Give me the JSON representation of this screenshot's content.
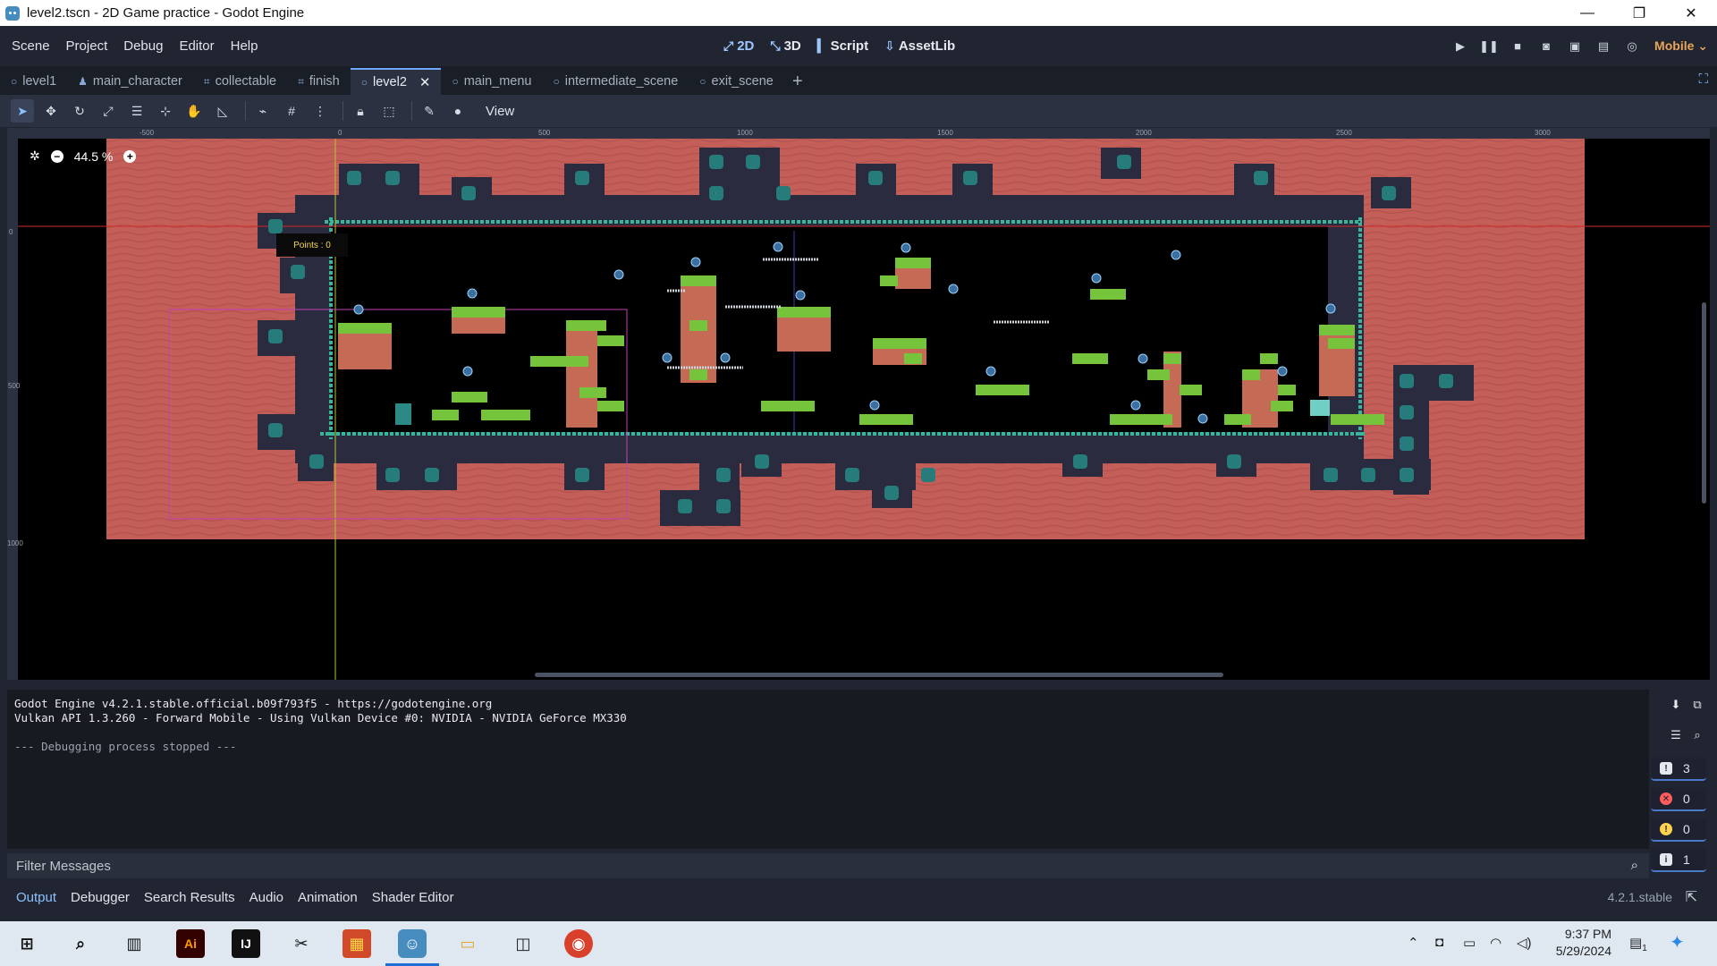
{
  "window": {
    "title": "level2.tscn - 2D Game practice - Godot Engine",
    "minimize": "—",
    "maximize": "❐",
    "close": "✕"
  },
  "menu": [
    "Scene",
    "Project",
    "Debug",
    "Editor",
    "Help"
  ],
  "modes": [
    {
      "icon": "⤢",
      "label": "2D",
      "active": true
    },
    {
      "icon": "⤡",
      "label": "3D"
    },
    {
      "icon": "▍",
      "label": "Script"
    },
    {
      "icon": "⇩",
      "label": "AssetLib"
    }
  ],
  "playbar": {
    "renderer": "Mobile ⌄"
  },
  "tabs": [
    {
      "icon": "○",
      "label": "level1"
    },
    {
      "icon": "♟",
      "label": "main_character"
    },
    {
      "icon": "⌗",
      "label": "collectable"
    },
    {
      "icon": "⌗",
      "label": "finish"
    },
    {
      "icon": "○",
      "label": "level2",
      "active": true,
      "close": "✕"
    },
    {
      "icon": "○",
      "label": "main_menu"
    },
    {
      "icon": "○",
      "label": "intermediate_scene"
    },
    {
      "icon": "○",
      "label": "exit_scene"
    }
  ],
  "tab_add": "+",
  "toolbar": {
    "view_label": "View"
  },
  "viewport": {
    "zoom": "44.5 %",
    "zoom_minus": "−",
    "zoom_plus": "+",
    "ruler_labels": [
      "-500",
      "0",
      "500",
      "1000",
      "1500",
      "2000",
      "2500",
      "3000"
    ],
    "ruler_left_labels": [
      "0",
      "500",
      "1000"
    ],
    "points_label": "Points : 0"
  },
  "output": {
    "lines": [
      "Godot Engine v4.2.1.stable.official.b09f793f5 - https://godotengine.org",
      "Vulkan API 1.3.260 - Forward Mobile - Using Vulkan Device #0: NVIDIA - NVIDIA GeForce MX330",
      "",
      "--- Debugging process stopped ---"
    ],
    "filter_placeholder": "Filter Messages",
    "counters": {
      "messages": "3",
      "errors": "0",
      "warnings": "0",
      "info": "1"
    }
  },
  "bottom_tabs": [
    "Output",
    "Debugger",
    "Search Results",
    "Audio",
    "Animation",
    "Shader Editor"
  ],
  "version": "4.2.1.stable",
  "taskbar": {
    "time": "9:37 PM",
    "date": "5/29/2024",
    "notifications": "1"
  }
}
